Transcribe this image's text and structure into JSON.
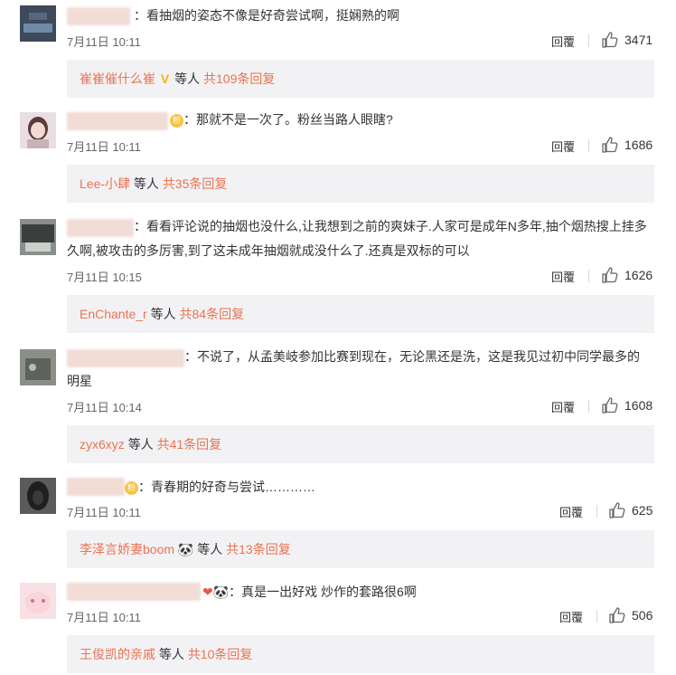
{
  "comments": [
    {
      "text": "：看抽烟的姿态不像是好奇尝试啊，挺娴熟的啊",
      "date": "7月11日 10:11",
      "reply_label": "回覆",
      "likes": "3471",
      "sub": {
        "user": "崔崔催什么崔",
        "badge": "V",
        "middle": "等人",
        "count_text": "共109条回复"
      }
    },
    {
      "text": "：那就不是一次了。粉丝当路人眼瞎?",
      "date": "7月11日 10:11",
      "reply_label": "回覆",
      "likes": "1686",
      "sub": {
        "user": "Lee-小肆",
        "middle": "等人",
        "count_text": "共35条回复"
      }
    },
    {
      "text": "：看看评论说的抽烟也没什么,让我想到之前的爽妹子.人家可是成年N多年,抽个烟热搜上挂多久啊,被攻击的多厉害,到了这未成年抽烟就成没什么了.还真是双标的可以",
      "date": "7月11日 10:15",
      "reply_label": "回覆",
      "likes": "1626",
      "sub": {
        "user": "EnChante_r",
        "middle": "等人",
        "count_text": "共84条回复"
      }
    },
    {
      "text": "：不说了，从孟美岐参加比赛到现在，无论黑还是洗，这是我见过初中同学最多的明星",
      "date": "7月11日 10:14",
      "reply_label": "回覆",
      "likes": "1608",
      "sub": {
        "user": "zyx6xyz",
        "middle": "等人",
        "count_text": "共41条回复"
      }
    },
    {
      "text": "：青春期的好奇与尝试…………",
      "date": "7月11日 10:11",
      "reply_label": "回覆",
      "likes": "625",
      "sub": {
        "user": "李泽言娇妻boom",
        "emoji": "🐼",
        "middle": "等人",
        "count_text": "共13条回复"
      }
    },
    {
      "text": "：真是一出好戏 炒作的套路很6啊",
      "date": "7月11日 10:11",
      "reply_label": "回覆",
      "likes": "506",
      "sub": {
        "user": "王俊凯的亲戚",
        "middle": "等人",
        "count_text": "共10条回复"
      }
    }
  ]
}
